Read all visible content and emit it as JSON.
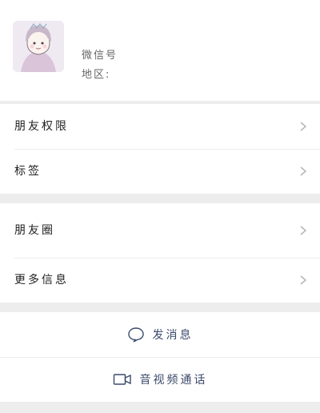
{
  "profile": {
    "wechat_id_label": "微信号",
    "region_label": "地区:"
  },
  "menu_group_1": [
    {
      "label": "朋友权限"
    },
    {
      "label": "标签"
    }
  ],
  "menu_group_2": [
    {
      "label": "朋友圈"
    },
    {
      "label": "更多信息"
    }
  ],
  "actions": {
    "send_message": "发消息",
    "video_call": "音视频通话"
  },
  "icons": {
    "chevron": "chevron-right-icon",
    "message": "chat-bubble-icon",
    "video": "video-camera-icon"
  },
  "colors": {
    "accent": "#3b4a6b",
    "background": "#ededed"
  }
}
